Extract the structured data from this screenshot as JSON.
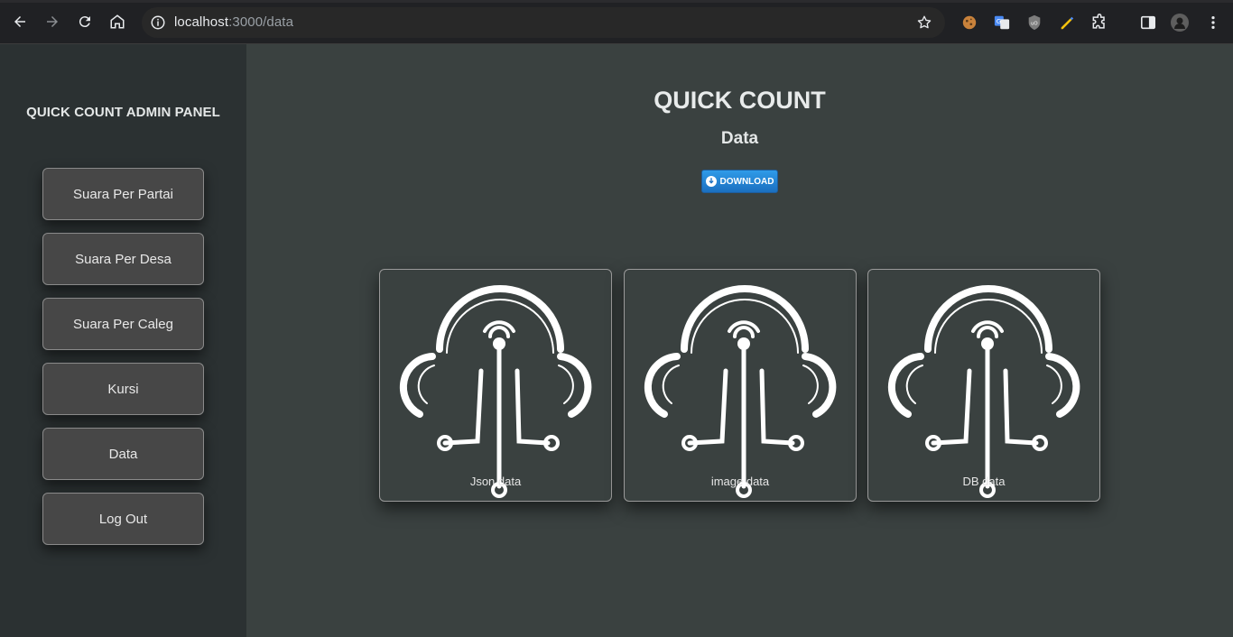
{
  "browser": {
    "url_host": "localhost",
    "url_path": ":3000/data"
  },
  "sidebar": {
    "title": "QUICK COUNT ADMIN PANEL",
    "items": [
      {
        "label": "Suara Per Partai"
      },
      {
        "label": "Suara Per Desa"
      },
      {
        "label": "Suara Per Caleg"
      },
      {
        "label": "Kursi"
      },
      {
        "label": "Data"
      },
      {
        "label": "Log Out"
      }
    ]
  },
  "main": {
    "title": "QUICK COUNT",
    "subtitle": "Data",
    "download_label": "DOWNLOAD",
    "cards": [
      {
        "label": "Json data",
        "icon": "cloud-data-icon"
      },
      {
        "label": "image data",
        "icon": "cloud-data-icon"
      },
      {
        "label": "DB data",
        "icon": "cloud-data-icon"
      }
    ]
  },
  "colors": {
    "sidebar_bg": "#2b3132",
    "main_bg": "#3a4140",
    "button_bg": "#474747",
    "download_blue": "#1b80d6"
  }
}
